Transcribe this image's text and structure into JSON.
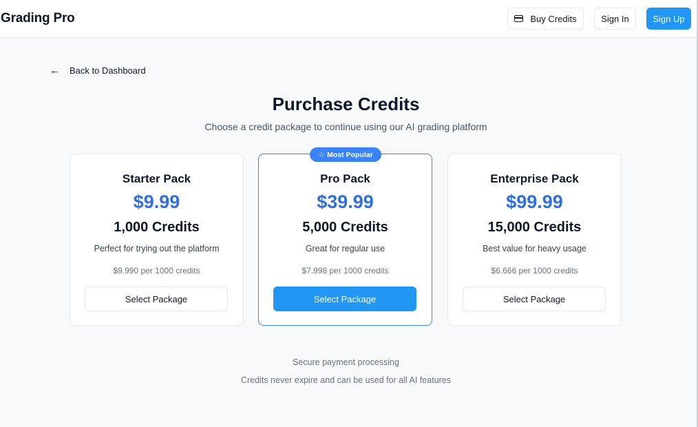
{
  "header": {
    "brand": "Grading Pro",
    "buy_credits": "Buy Credits",
    "sign_in": "Sign In",
    "sign_up": "Sign Up",
    "buy_icon": "credit-card-icon"
  },
  "back_link": {
    "label": "Back to Dashboard",
    "icon": "arrow-left-icon"
  },
  "title": "Purchase Credits",
  "subtitle": "Choose a credit package to continue using our AI grading platform",
  "packages": [
    {
      "name": "Starter Pack",
      "price": "$9.99",
      "credits": "1,000 Credits",
      "description": "Perfect for trying out the platform",
      "rate": "$9.990 per 1000 credits",
      "button": "Select Package"
    },
    {
      "name": "Pro Pack",
      "price": "$39.99",
      "credits": "5,000 Credits",
      "description": "Great for regular use",
      "rate": "$7.998 per 1000 credits",
      "button": "Select Package",
      "badge": "Most Popular",
      "badge_icon": "star-icon"
    },
    {
      "name": "Enterprise Pack",
      "price": "$99.99",
      "credits": "15,000 Credits",
      "description": "Best value for heavy usage",
      "rate": "$6.666 per 1000 credits",
      "button": "Select Package"
    }
  ],
  "footer": {
    "line1": "Secure payment processing",
    "line2": "Credits never expire and can be used for all AI features"
  },
  "colors": {
    "accent": "#2196f3",
    "price": "#2f6fe0",
    "popular_border": "#3b82f6"
  }
}
